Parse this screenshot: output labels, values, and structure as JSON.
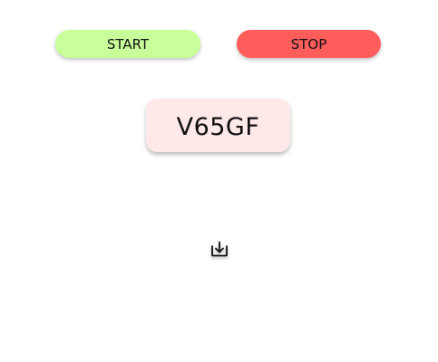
{
  "controls": {
    "start_label": "START",
    "stop_label": "STOP"
  },
  "display": {
    "code": "V65GF"
  },
  "icons": {
    "download": "download-tray-icon"
  },
  "colors": {
    "start_bg": "#c9ff9a",
    "stop_bg": "#ff5c5c",
    "code_bg": "#ffe8e8"
  }
}
